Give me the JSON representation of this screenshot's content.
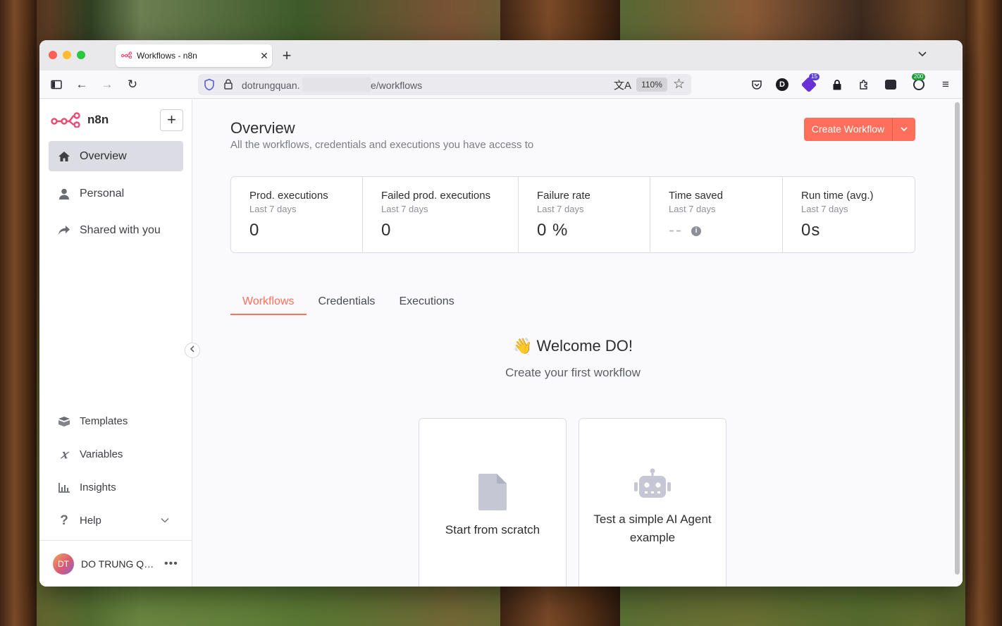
{
  "browser": {
    "tab_title": "Workflows - n8n",
    "url_visible_left": "dotrungquan.",
    "url_visible_right": "e/workflows",
    "zoom": "110%",
    "ext_badge_1": "15",
    "ext_badge_2": "200"
  },
  "sidebar": {
    "brand": "n8n",
    "items": [
      {
        "label": "Overview"
      },
      {
        "label": "Personal"
      },
      {
        "label": "Shared with you"
      }
    ],
    "bottom_items": [
      {
        "label": "Templates"
      },
      {
        "label": "Variables"
      },
      {
        "label": "Insights"
      },
      {
        "label": "Help"
      }
    ],
    "user": {
      "initials": "DT",
      "name": "DO TRUNG QU...",
      "more": "•••"
    }
  },
  "header": {
    "title": "Overview",
    "subtitle": "All the workflows, credentials and executions you have access to",
    "create_button": "Create Workflow"
  },
  "stats": [
    {
      "label": "Prod. executions",
      "period": "Last 7 days",
      "value": "0"
    },
    {
      "label": "Failed prod. executions",
      "period": "Last 7 days",
      "value": "0"
    },
    {
      "label": "Failure rate",
      "period": "Last 7 days",
      "value": "0 %"
    },
    {
      "label": "Time saved",
      "period": "Last 7 days",
      "value": "--"
    },
    {
      "label": "Run time (avg.)",
      "period": "Last 7 days",
      "value": "0s"
    }
  ],
  "tabs": [
    {
      "label": "Workflows",
      "active": true
    },
    {
      "label": "Credentials"
    },
    {
      "label": "Executions"
    }
  ],
  "empty_state": {
    "welcome": "👋 Welcome DO!",
    "subtitle": "Create your first workflow",
    "cards": [
      {
        "label": "Start from scratch",
        "icon": "file-icon"
      },
      {
        "label": "Test a simple AI Agent example",
        "icon": "robot-icon"
      }
    ]
  },
  "watermark": "DOTRUNGQUAN",
  "colors": {
    "accent": "#ff6f5c",
    "active_item_bg": "#dcdde4"
  }
}
